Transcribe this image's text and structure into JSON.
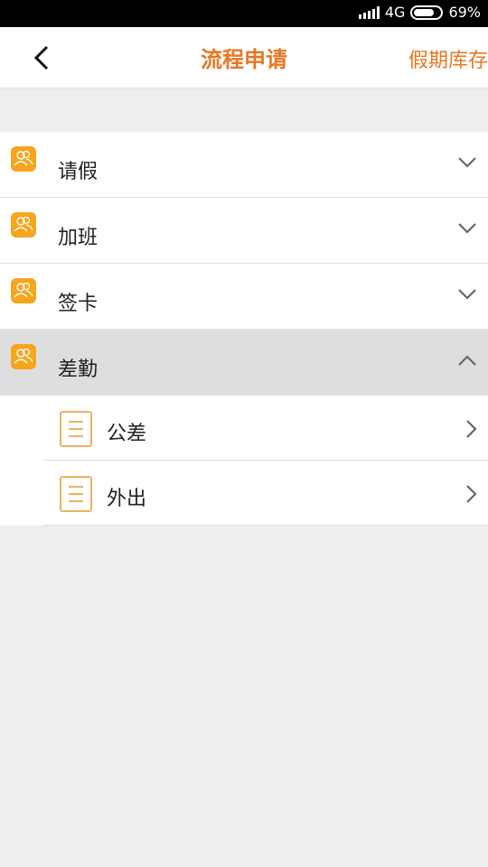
{
  "status_bar": {
    "network": "4G",
    "battery_percent": "69%",
    "battery_level": 0.69
  },
  "header": {
    "title": "流程申请",
    "right_action": "假期库存"
  },
  "categories": [
    {
      "label": "请假",
      "expanded": false
    },
    {
      "label": "加班",
      "expanded": false
    },
    {
      "label": "签卡",
      "expanded": false
    },
    {
      "label": "差勤",
      "expanded": true,
      "children": [
        {
          "label": "公差"
        },
        {
          "label": "外出"
        }
      ]
    }
  ],
  "colors": {
    "accent": "#e87722",
    "category_icon": "#f7a51c",
    "doc_icon": "#f0b065",
    "background": "#eeeeee"
  }
}
